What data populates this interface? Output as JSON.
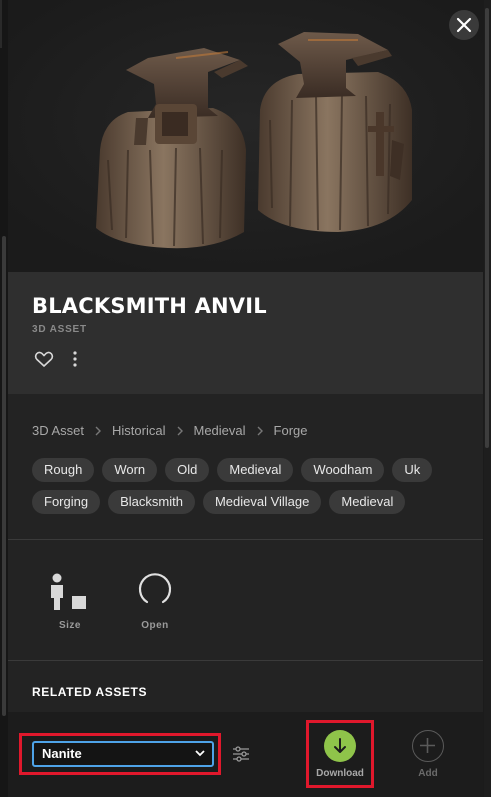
{
  "asset": {
    "title": "BLACKSMITH ANVIL",
    "type_label": "3D ASSET"
  },
  "icons": {
    "close": "close-icon",
    "favorite": "heart-icon",
    "more": "more-vertical-icon",
    "size": "size-comparison-icon",
    "open": "loading-spinner-icon",
    "filters": "sliders-icon",
    "download": "arrow-down-icon",
    "add": "plus-icon"
  },
  "breadcrumb": [
    "3D Asset",
    "Historical",
    "Medieval",
    "Forge"
  ],
  "tags": [
    "Rough",
    "Worn",
    "Old",
    "Medieval",
    "Woodham",
    "Uk",
    "Forging",
    "Blacksmith",
    "Medieval Village",
    "Medieval"
  ],
  "tools": {
    "size_label": "Size",
    "open_label": "Open"
  },
  "related": {
    "heading": "RELATED ASSETS"
  },
  "footer": {
    "quality_selected": "Nanite",
    "download_label": "Download",
    "add_label": "Add"
  },
  "colors": {
    "accent_green": "#8fc44a",
    "highlight_red": "#e0182c",
    "focus_blue": "#4ea3e8",
    "background": "#232323"
  }
}
